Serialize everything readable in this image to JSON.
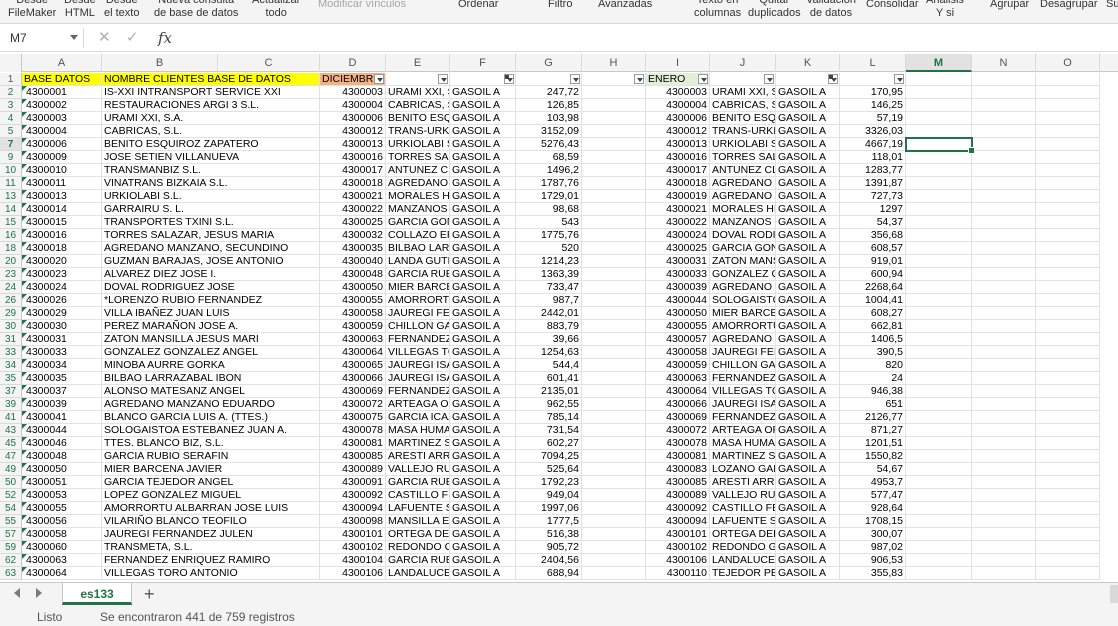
{
  "ribbon": {
    "items": [
      {
        "l1": "Desde",
        "l2": "FileMaker"
      },
      {
        "l1": "Desde",
        "l2": "HTML"
      },
      {
        "l1": "Desde",
        "l2": "el texto"
      },
      {
        "l1": "Nueva consulta",
        "l2": "de base de datos"
      },
      {
        "l1": "Actualizar",
        "l2": "todo"
      },
      {
        "l1": "Modificar vínculos",
        "l2": ""
      },
      {
        "l1": "Ordenar",
        "l2": ""
      },
      {
        "l1": "Filtro",
        "l2": ""
      },
      {
        "l1": "Avanzadas",
        "l2": ""
      },
      {
        "l1": "Texto en",
        "l2": "columnas"
      },
      {
        "l1": "Quitar",
        "l2": "duplicados"
      },
      {
        "l1": "Validación",
        "l2": "de datos"
      },
      {
        "l1": "Consolidar",
        "l2": ""
      },
      {
        "l1": "Análisis",
        "l2": "Y si"
      },
      {
        "l1": "Agrupar",
        "l2": ""
      },
      {
        "l1": "Desagrupar",
        "l2": ""
      },
      {
        "l1": "Su",
        "l2": ""
      }
    ]
  },
  "formula_bar": {
    "name_box": "M7",
    "cancel_glyph": "✕",
    "enter_glyph": "✓",
    "fx_glyph": "fx",
    "value": ""
  },
  "columns": [
    "A",
    "B",
    "C",
    "D",
    "E",
    "F",
    "G",
    "H",
    "I",
    "J",
    "K",
    "L",
    "M",
    "N",
    "O"
  ],
  "active_column": "M",
  "active_row": "7",
  "header_row": {
    "num": "1",
    "a": "BASE DATOS",
    "b": "NOMBRE CLIENTES BASE DE DATOS",
    "d": "DICIEMBR",
    "i": "ENERO"
  },
  "rows": [
    {
      "n": "2",
      "a": "4300001",
      "b": "IS-XXI INTRANSPORT SERVICE XXI",
      "d": "4300003",
      "e": "URAMI XXI, S",
      "f": "GASOIL A",
      "g": "247,72",
      "i": "4300003",
      "j": "URAMI XXI, S",
      "k": "GASOIL A",
      "l": "170,95"
    },
    {
      "n": "3",
      "a": "4300002",
      "b": "RESTAURACIONES ARGI 3 S.L.",
      "d": "4300004",
      "e": "CABRICAS, S",
      "f": "GASOIL A",
      "g": "126,85",
      "i": "4300004",
      "j": "CABRICAS, S",
      "k": "GASOIL A",
      "l": "146,25"
    },
    {
      "n": "4",
      "a": "4300003",
      "b": "URAMI XXI, S.A.",
      "d": "4300006",
      "e": "BENITO ESQ",
      "f": "GASOIL A",
      "g": "103,98",
      "i": "4300006",
      "j": "BENITO ESQ",
      "k": "GASOIL A",
      "l": "57,19"
    },
    {
      "n": "5",
      "a": "4300004",
      "b": "CABRICAS, S.L.",
      "d": "4300012",
      "e": "TRANS-URKI",
      "f": "GASOIL A",
      "g": "3152,09",
      "i": "4300012",
      "j": "TRANS-URKI",
      "k": "GASOIL A",
      "l": "3326,03"
    },
    {
      "n": "7",
      "a": "4300006",
      "b": "BENITO ESQUIROZ ZAPATERO",
      "d": "4300013",
      "e": "URKIOLABI S",
      "f": "GASOIL A",
      "g": "5276,43",
      "i": "4300013",
      "j": "URKIOLABI S",
      "k": "GASOIL A",
      "l": "4667,19"
    },
    {
      "n": "9",
      "a": "4300009",
      "b": "JOSE SETIEN VILLANUEVA",
      "d": "4300016",
      "e": "TORRES SAL",
      "f": "GASOIL A",
      "g": "68,59",
      "i": "4300016",
      "j": "TORRES SAL",
      "k": "GASOIL A",
      "l": "118,01"
    },
    {
      "n": "10",
      "a": "4300010",
      "b": "TRANSMANBIZ S.L.",
      "d": "4300017",
      "e": "ANTUNEZ CL",
      "f": "GASOIL A",
      "g": "1496,2",
      "i": "4300017",
      "j": "ANTUNEZ CL",
      "k": "GASOIL A",
      "l": "1283,77"
    },
    {
      "n": "11",
      "a": "4300011",
      "b": "VINATRANS BIZKAIA S.L.",
      "d": "4300018",
      "e": "AGREDANO I",
      "f": "GASOIL A",
      "g": "1787,76",
      "i": "4300018",
      "j": "AGREDANO I",
      "k": "GASOIL A",
      "l": "1391,87"
    },
    {
      "n": "13",
      "a": "4300013",
      "b": "URKIOLABI S.L.",
      "d": "4300021",
      "e": "MORALES HI",
      "f": "GASOIL A",
      "g": "1729,01",
      "i": "4300019",
      "j": "AGREDANO I",
      "k": "GASOIL A",
      "l": "727,73"
    },
    {
      "n": "14",
      "a": "4300014",
      "b": "GARRAIRU S. L.",
      "d": "4300022",
      "e": "MANZANOS I",
      "f": "GASOIL A",
      "g": "98,68",
      "i": "4300021",
      "j": "MORALES HI",
      "k": "GASOIL A",
      "l": "1297"
    },
    {
      "n": "15",
      "a": "4300015",
      "b": "TRANSPORTES TXINI S.L.",
      "d": "4300025",
      "e": "GARCIA GON",
      "f": "GASOIL A",
      "g": "543",
      "i": "4300022",
      "j": "MANZANOS I",
      "k": "GASOIL A",
      "l": "54,37"
    },
    {
      "n": "16",
      "a": "4300016",
      "b": "TORRES SALAZAR, JESUS MARIA",
      "d": "4300032",
      "e": "COLLAZO ER",
      "f": "GASOIL A",
      "g": "1775,76",
      "i": "4300024",
      "j": "DOVAL RODI",
      "k": "GASOIL A",
      "l": "356,68"
    },
    {
      "n": "18",
      "a": "4300018",
      "b": "AGREDANO MANZANO, SECUNDINO",
      "d": "4300035",
      "e": "BILBAO LARI",
      "f": "GASOIL A",
      "g": "520",
      "i": "4300025",
      "j": "GARCIA GON",
      "k": "GASOIL A",
      "l": "608,57"
    },
    {
      "n": "20",
      "a": "4300020",
      "b": "GUZMAN BARAJAS, JOSE ANTONIO",
      "d": "4300040",
      "e": "LANDA GUTII",
      "f": "GASOIL A",
      "g": "1214,23",
      "i": "4300031",
      "j": "ZATON MANS",
      "k": "GASOIL A",
      "l": "919,01"
    },
    {
      "n": "23",
      "a": "4300023",
      "b": "ALVAREZ DIEZ JOSE I.",
      "d": "4300048",
      "e": "GARCIA RUB",
      "f": "GASOIL A",
      "g": "1363,39",
      "i": "4300033",
      "j": "GONZALEZ G",
      "k": "GASOIL A",
      "l": "600,94"
    },
    {
      "n": "24",
      "a": "4300024",
      "b": "DOVAL RODRIGUEZ JOSE",
      "d": "4300050",
      "e": "MIER BARCE",
      "f": "GASOIL A",
      "g": "733,47",
      "i": "4300039",
      "j": "AGREDANO I",
      "k": "GASOIL A",
      "l": "2268,64"
    },
    {
      "n": "26",
      "a": "4300026",
      "b": "*LORENZO RUBIO FERNANDEZ",
      "d": "4300055",
      "e": "AMORRORTU",
      "f": "GASOIL A",
      "g": "987,7",
      "i": "4300044",
      "j": "SOLOGAISTC",
      "k": "GASOIL A",
      "l": "1004,41"
    },
    {
      "n": "29",
      "a": "4300029",
      "b": "VILLA IBAÑEZ JUAN LUIS",
      "d": "4300058",
      "e": "JAUREGI FEI",
      "f": "GASOIL A",
      "g": "2442,01",
      "i": "4300050",
      "j": "MIER BARCE",
      "k": "GASOIL A",
      "l": "608,27"
    },
    {
      "n": "30",
      "a": "4300030",
      "b": "PEREZ MARAÑON JOSE A.",
      "d": "4300059",
      "e": "CHILLON GAI",
      "f": "GASOIL A",
      "g": "883,79",
      "i": "4300055",
      "j": "AMORRORTU",
      "k": "GASOIL A",
      "l": "662,81"
    },
    {
      "n": "31",
      "a": "4300031",
      "b": "ZATON MANSILLA JESUS MARI",
      "d": "4300063",
      "e": "FERNANDEZ",
      "f": "GASOIL A",
      "g": "39,66",
      "i": "4300057",
      "j": "AGREDANO I",
      "k": "GASOIL A",
      "l": "1406,5"
    },
    {
      "n": "33",
      "a": "4300033",
      "b": "GONZALEZ GONZALEZ ANGEL",
      "d": "4300064",
      "e": "VILLEGAS TC",
      "f": "GASOIL A",
      "g": "1254,63",
      "i": "4300058",
      "j": "JAUREGI FEI",
      "k": "GASOIL A",
      "l": "390,5"
    },
    {
      "n": "34",
      "a": "4300034",
      "b": "MINOBA AURRE GORKA",
      "d": "4300065",
      "e": "JAUREGI ISA",
      "f": "GASOIL A",
      "g": "544,4",
      "i": "4300059",
      "j": "CHILLON GAI",
      "k": "GASOIL A",
      "l": "820"
    },
    {
      "n": "35",
      "a": "4300035",
      "b": "BILBAO LARRAZABAL IBON",
      "d": "4300066",
      "e": "JAUREGI ISA",
      "f": "GASOIL A",
      "g": "601,41",
      "i": "4300063",
      "j": "FERNANDEZ",
      "k": "GASOIL A",
      "l": "24"
    },
    {
      "n": "37",
      "a": "4300037",
      "b": "ALONSO MATESANZ ANGEL",
      "d": "4300069",
      "e": "FERNANDEZ",
      "f": "GASOIL A",
      "g": "2135,01",
      "i": "4300064",
      "j": "VILLEGAS TC",
      "k": "GASOIL A",
      "l": "946,38"
    },
    {
      "n": "39",
      "a": "4300039",
      "b": "AGREDANO MANZANO EDUARDO",
      "d": "4300072",
      "e": "ARTEAGA OF",
      "f": "GASOIL A",
      "g": "962,55",
      "i": "4300066",
      "j": "JAUREGI ISA",
      "k": "GASOIL A",
      "l": "651"
    },
    {
      "n": "41",
      "a": "4300041",
      "b": "BLANCO GARCIA LUIS A. (TTES.)",
      "d": "4300075",
      "e": "GARCIA ICAZ",
      "f": "GASOIL A",
      "g": "785,14",
      "i": "4300069",
      "j": "FERNANDEZ",
      "k": "GASOIL A",
      "l": "2126,77"
    },
    {
      "n": "43",
      "a": "4300044",
      "b": "SOLOGAISTOA ESTEBANEZ JUAN A.",
      "d": "4300078",
      "e": "MASA HUMAI",
      "f": "GASOIL A",
      "g": "731,54",
      "i": "4300072",
      "j": "ARTEAGA OF",
      "k": "GASOIL A",
      "l": "871,27"
    },
    {
      "n": "45",
      "a": "4300046",
      "b": "TTES. BLANCO BIZ, S.L.",
      "d": "4300081",
      "e": "MARTINEZ S.",
      "f": "GASOIL A",
      "g": "602,27",
      "i": "4300078",
      "j": "MASA HUMAI",
      "k": "GASOIL A",
      "l": "1201,51"
    },
    {
      "n": "47",
      "a": "4300048",
      "b": "GARCIA RUBIO SERAFIN",
      "d": "4300085",
      "e": "ARESTI ARRI",
      "f": "GASOIL A",
      "g": "7094,25",
      "i": "4300081",
      "j": "MARTINEZ S.",
      "k": "GASOIL A",
      "l": "1550,82"
    },
    {
      "n": "49",
      "a": "4300050",
      "b": "MIER BARCENA JAVIER",
      "d": "4300089",
      "e": "VALLEJO RU",
      "f": "GASOIL A",
      "g": "525,64",
      "i": "4300083",
      "j": "LOZANO GAF",
      "k": "GASOIL A",
      "l": "54,67"
    },
    {
      "n": "50",
      "a": "4300051",
      "b": "GARCIA TEJEDOR ANGEL",
      "d": "4300091",
      "e": "GARCIA RUB",
      "f": "GASOIL A",
      "g": "1792,23",
      "i": "4300085",
      "j": "ARESTI ARRI",
      "k": "GASOIL A",
      "l": "4953,7"
    },
    {
      "n": "52",
      "a": "4300053",
      "b": "LOPEZ GONZALEZ MIGUEL",
      "d": "4300092",
      "e": "CASTILLO FE",
      "f": "GASOIL A",
      "g": "949,04",
      "i": "4300089",
      "j": "VALLEJO RU",
      "k": "GASOIL A",
      "l": "577,47"
    },
    {
      "n": "54",
      "a": "4300055",
      "b": "AMORRORTU ALBARRAN JOSE LUIS",
      "d": "4300094",
      "e": "LAFUENTE S",
      "f": "GASOIL A",
      "g": "1997,06",
      "i": "4300092",
      "j": "CASTILLO FE",
      "k": "GASOIL A",
      "l": "928,64"
    },
    {
      "n": "55",
      "a": "4300056",
      "b": "VILARIÑO BLANCO TEOFILO",
      "d": "4300098",
      "e": "MANSILLA ES",
      "f": "GASOIL A",
      "g": "1777,5",
      "i": "4300094",
      "j": "LAFUENTE S",
      "k": "GASOIL A",
      "l": "1708,15"
    },
    {
      "n": "57",
      "a": "4300058",
      "b": "JAUREGI FERNANDEZ JULEN",
      "d": "4300101",
      "e": "ORTEGA DEL",
      "f": "GASOIL A",
      "g": "516,38",
      "i": "4300101",
      "j": "ORTEGA DEL",
      "k": "GASOIL A",
      "l": "300,07"
    },
    {
      "n": "59",
      "a": "4300060",
      "b": "TRANSMETA, S.L.",
      "d": "4300102",
      "e": "REDONDO G",
      "f": "GASOIL A",
      "g": "905,72",
      "i": "4300102",
      "j": "REDONDO G",
      "k": "GASOIL A",
      "l": "987,02"
    },
    {
      "n": "62",
      "a": "4300063",
      "b": "FERNANDEZ ENRIQUEZ RAMIRO",
      "d": "4300104",
      "e": "GARCIA RUB",
      "f": "GASOIL A",
      "g": "2404,56",
      "i": "4300106",
      "j": "LANDALUCE",
      "k": "GASOIL A",
      "l": "906,53"
    },
    {
      "n": "63",
      "a": "4300064",
      "b": "VILLEGAS TORO ANTONIO",
      "d": "4300106",
      "e": "LANDALUCE",
      "f": "GASOIL A",
      "g": "688,94",
      "i": "4300110",
      "j": "TEJEDOR PE",
      "k": "GASOIL A",
      "l": "355,83"
    }
  ],
  "sheet_tabs": {
    "active": "es133",
    "add_glyph": "+"
  },
  "status": {
    "ready": "Listo",
    "count": "Se encontraron 441 de 759 registros"
  },
  "colors": {
    "accent": "#217346",
    "header_yellow": "#ffff00",
    "header_orange": "#f4b183",
    "header_green": "#e2f0d9"
  }
}
